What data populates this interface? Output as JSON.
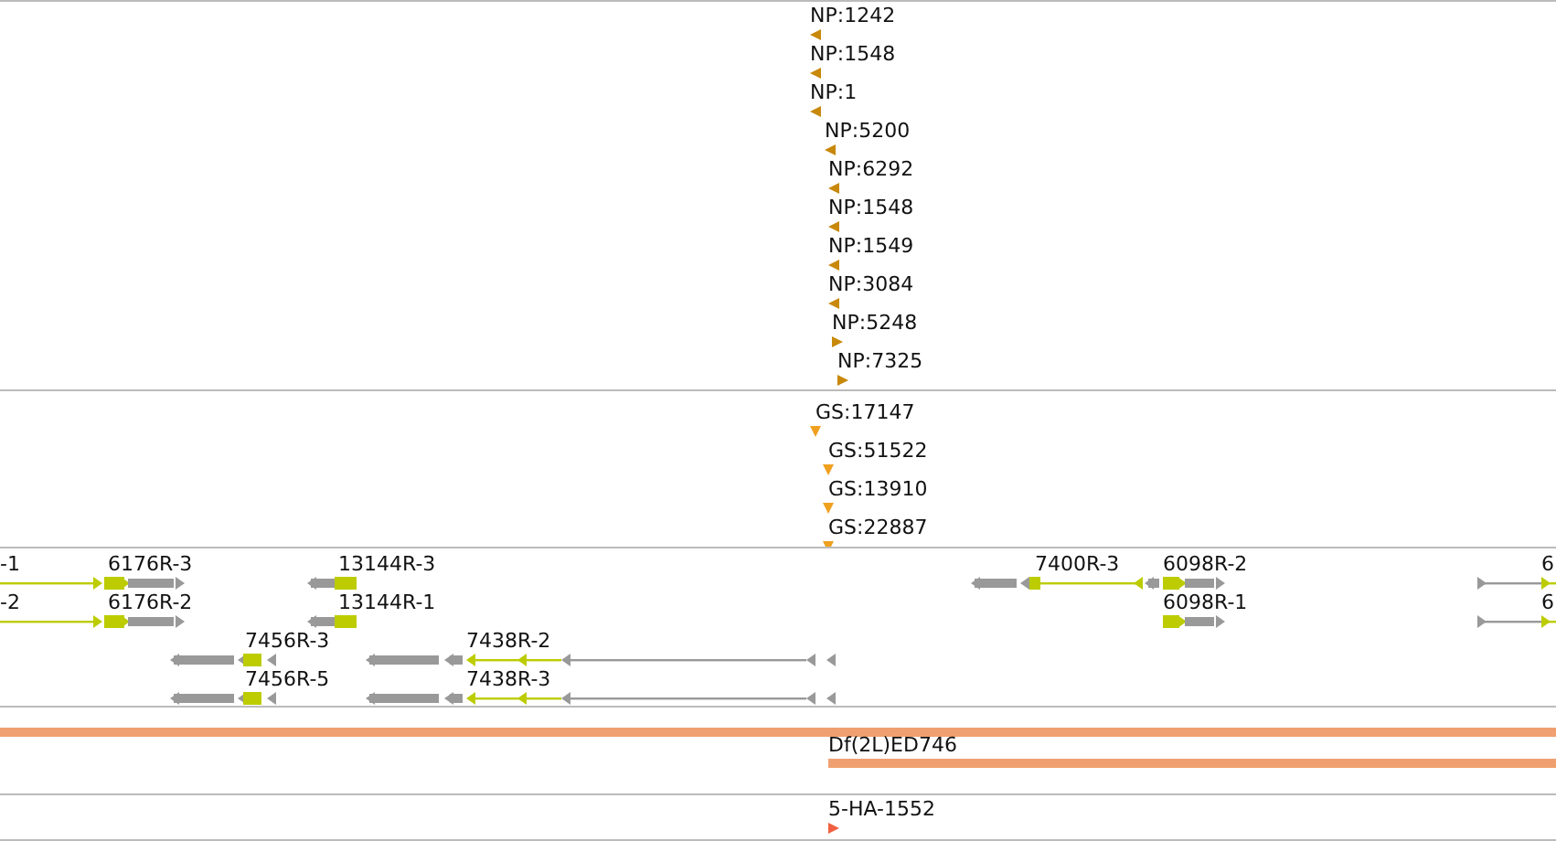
{
  "tracks": [
    {
      "kind": "markers",
      "color": "#c8880a",
      "features": [
        {
          "label": "NP:1242",
          "kind": "left"
        },
        {
          "label": "NP:1548",
          "kind": "left"
        },
        {
          "label": "NP:1",
          "kind": "left"
        },
        {
          "label": "NP:5200",
          "kind": "left"
        },
        {
          "label": "NP:6292",
          "kind": "left"
        },
        {
          "label": "NP:1548",
          "kind": "left"
        },
        {
          "label": "NP:1549",
          "kind": "left"
        },
        {
          "label": "NP:3084",
          "kind": "left"
        },
        {
          "label": "NP:5248",
          "kind": "right"
        },
        {
          "label": "NP:7325",
          "kind": "right"
        }
      ]
    },
    {
      "kind": "markers",
      "color": "#f0a020",
      "features": [
        {
          "label": "GS:17147",
          "kind": "down"
        },
        {
          "label": "GS:51522",
          "kind": "down"
        },
        {
          "label": "GS:13910",
          "kind": "down"
        },
        {
          "label": "GS:22887",
          "kind": "down"
        }
      ]
    },
    {
      "kind": "transcripts",
      "features": [
        {
          "label": "-1"
        },
        {
          "label": "6176R-3"
        },
        {
          "label": "13144R-3"
        },
        {
          "label": "7400R-3"
        },
        {
          "label": "6098R-2"
        },
        {
          "label": "6"
        },
        {
          "label": "-2"
        },
        {
          "label": "6176R-2"
        },
        {
          "label": "13144R-1"
        },
        {
          "label": "6098R-1"
        },
        {
          "label": "6"
        },
        {
          "label": "7456R-3"
        },
        {
          "label": "7438R-2"
        },
        {
          "label": "7456R-5"
        },
        {
          "label": "7438R-3"
        }
      ]
    },
    {
      "kind": "bars",
      "color": "#f0a070",
      "features": [
        {
          "kind": "bar"
        },
        {
          "kind": "bar",
          "label": "Df(2L)ED746"
        }
      ]
    },
    {
      "kind": "markers",
      "color": "#f06040",
      "features": [
        {
          "label": "5-HA-1552",
          "kind": "right"
        }
      ]
    }
  ]
}
